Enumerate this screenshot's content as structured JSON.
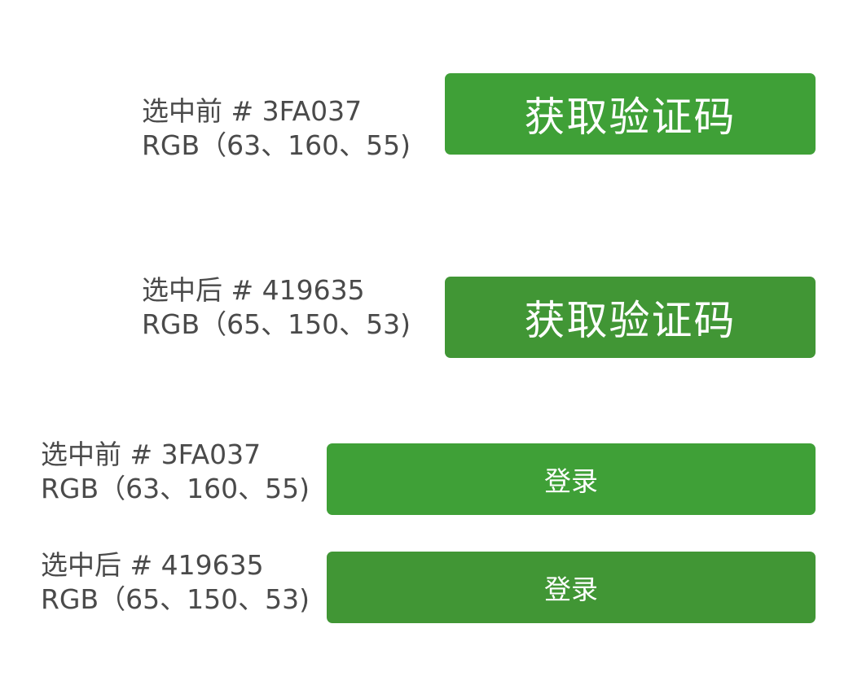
{
  "colors": {
    "before": "#3FA037",
    "after": "#419635",
    "label_text": "#4a4a4a"
  },
  "sections": [
    {
      "label_line1": "选中前 # 3FA037",
      "label_line2": "RGB（63、160、55)",
      "button_label": "获取验证码",
      "state": "before"
    },
    {
      "label_line1": "选中后 # 419635",
      "label_line2": "RGB（65、150、53)",
      "button_label": "获取验证码",
      "state": "after"
    },
    {
      "label_line1": "选中前 # 3FA037",
      "label_line2": "RGB（63、160、55)",
      "button_label": "登录",
      "state": "before"
    },
    {
      "label_line1": "选中后 # 419635",
      "label_line2": "RGB（65、150、53)",
      "button_label": "登录",
      "state": "after"
    }
  ]
}
